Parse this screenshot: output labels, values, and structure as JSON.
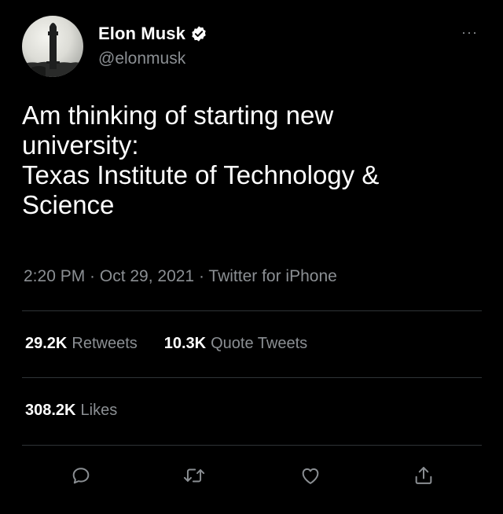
{
  "author": {
    "name": "Elon Musk",
    "handle": "@elonmusk",
    "verified": true,
    "avatar_icon": "rocket-starship-avatar"
  },
  "more_label": "···",
  "tweet": {
    "text": "Am thinking of starting new\nuniversity:\nTexas Institute of Technology &\nScience",
    "meta": "2:20 PM · Oct 29, 2021 · Twitter for iPhone"
  },
  "stats": {
    "retweets_count": "29.2K",
    "retweets_label": "Retweets",
    "quotes_count": "10.3K",
    "quotes_label": "Quote Tweets",
    "likes_count": "308.2K",
    "likes_label": "Likes"
  },
  "actions": [
    {
      "icon": "reply-icon"
    },
    {
      "icon": "retweet-icon"
    },
    {
      "icon": "like-icon"
    },
    {
      "icon": "share-icon"
    }
  ],
  "colors": {
    "background": "#000000",
    "primary_text": "#ffffff",
    "secondary_text": "#8b8f93",
    "divider": "#2f3336"
  }
}
